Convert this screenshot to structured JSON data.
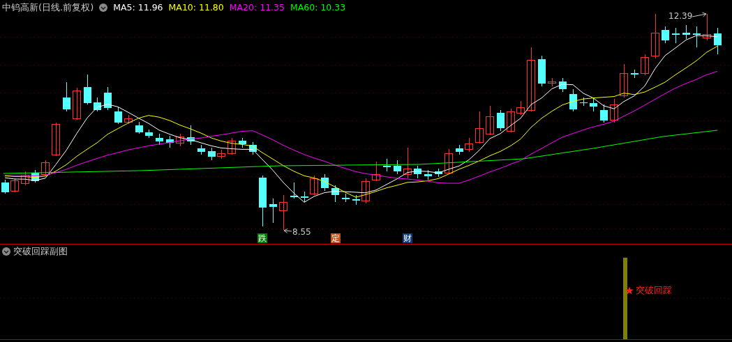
{
  "main_chart": {
    "title": "中钨高新(日线.前复权)",
    "moving_averages": [
      {
        "label": "MA5: 11.96",
        "color": "#ffffff"
      },
      {
        "label": "MA10: 11.80",
        "color": "#ffff00"
      },
      {
        "label": "MA20: 11.35",
        "color": "#ff00ff"
      },
      {
        "label": "MA60: 10.33",
        "color": "#00ff00"
      }
    ],
    "high_label": "12.39",
    "low_label": "8.55",
    "markers": [
      {
        "text": "跌",
        "color": "#008000"
      },
      {
        "text": "定",
        "color": "#c0501c"
      },
      {
        "text": "财",
        "color": "#0c3c78"
      }
    ]
  },
  "sub_chart": {
    "title": "突破回踩副图",
    "signal_label": "突破回踩"
  }
}
